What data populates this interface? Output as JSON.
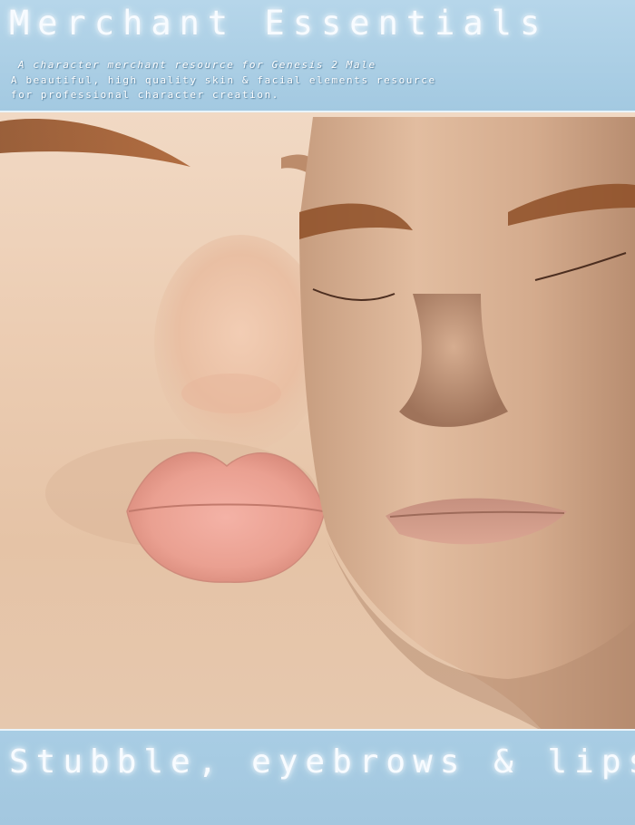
{
  "header": {
    "title": "Merchant Essentials",
    "tagline": "A character merchant resource for Genesis 2 Male",
    "description_line1": "A beautiful, high quality skin & facial elements resource",
    "description_line2": "for professional character creation."
  },
  "footer": {
    "caption": "Stubble, eyebrows & lips"
  },
  "colors": {
    "banner_blue": "#a9cde3",
    "title_glow": "#f7fbff",
    "skin": "#e8c7ab"
  }
}
